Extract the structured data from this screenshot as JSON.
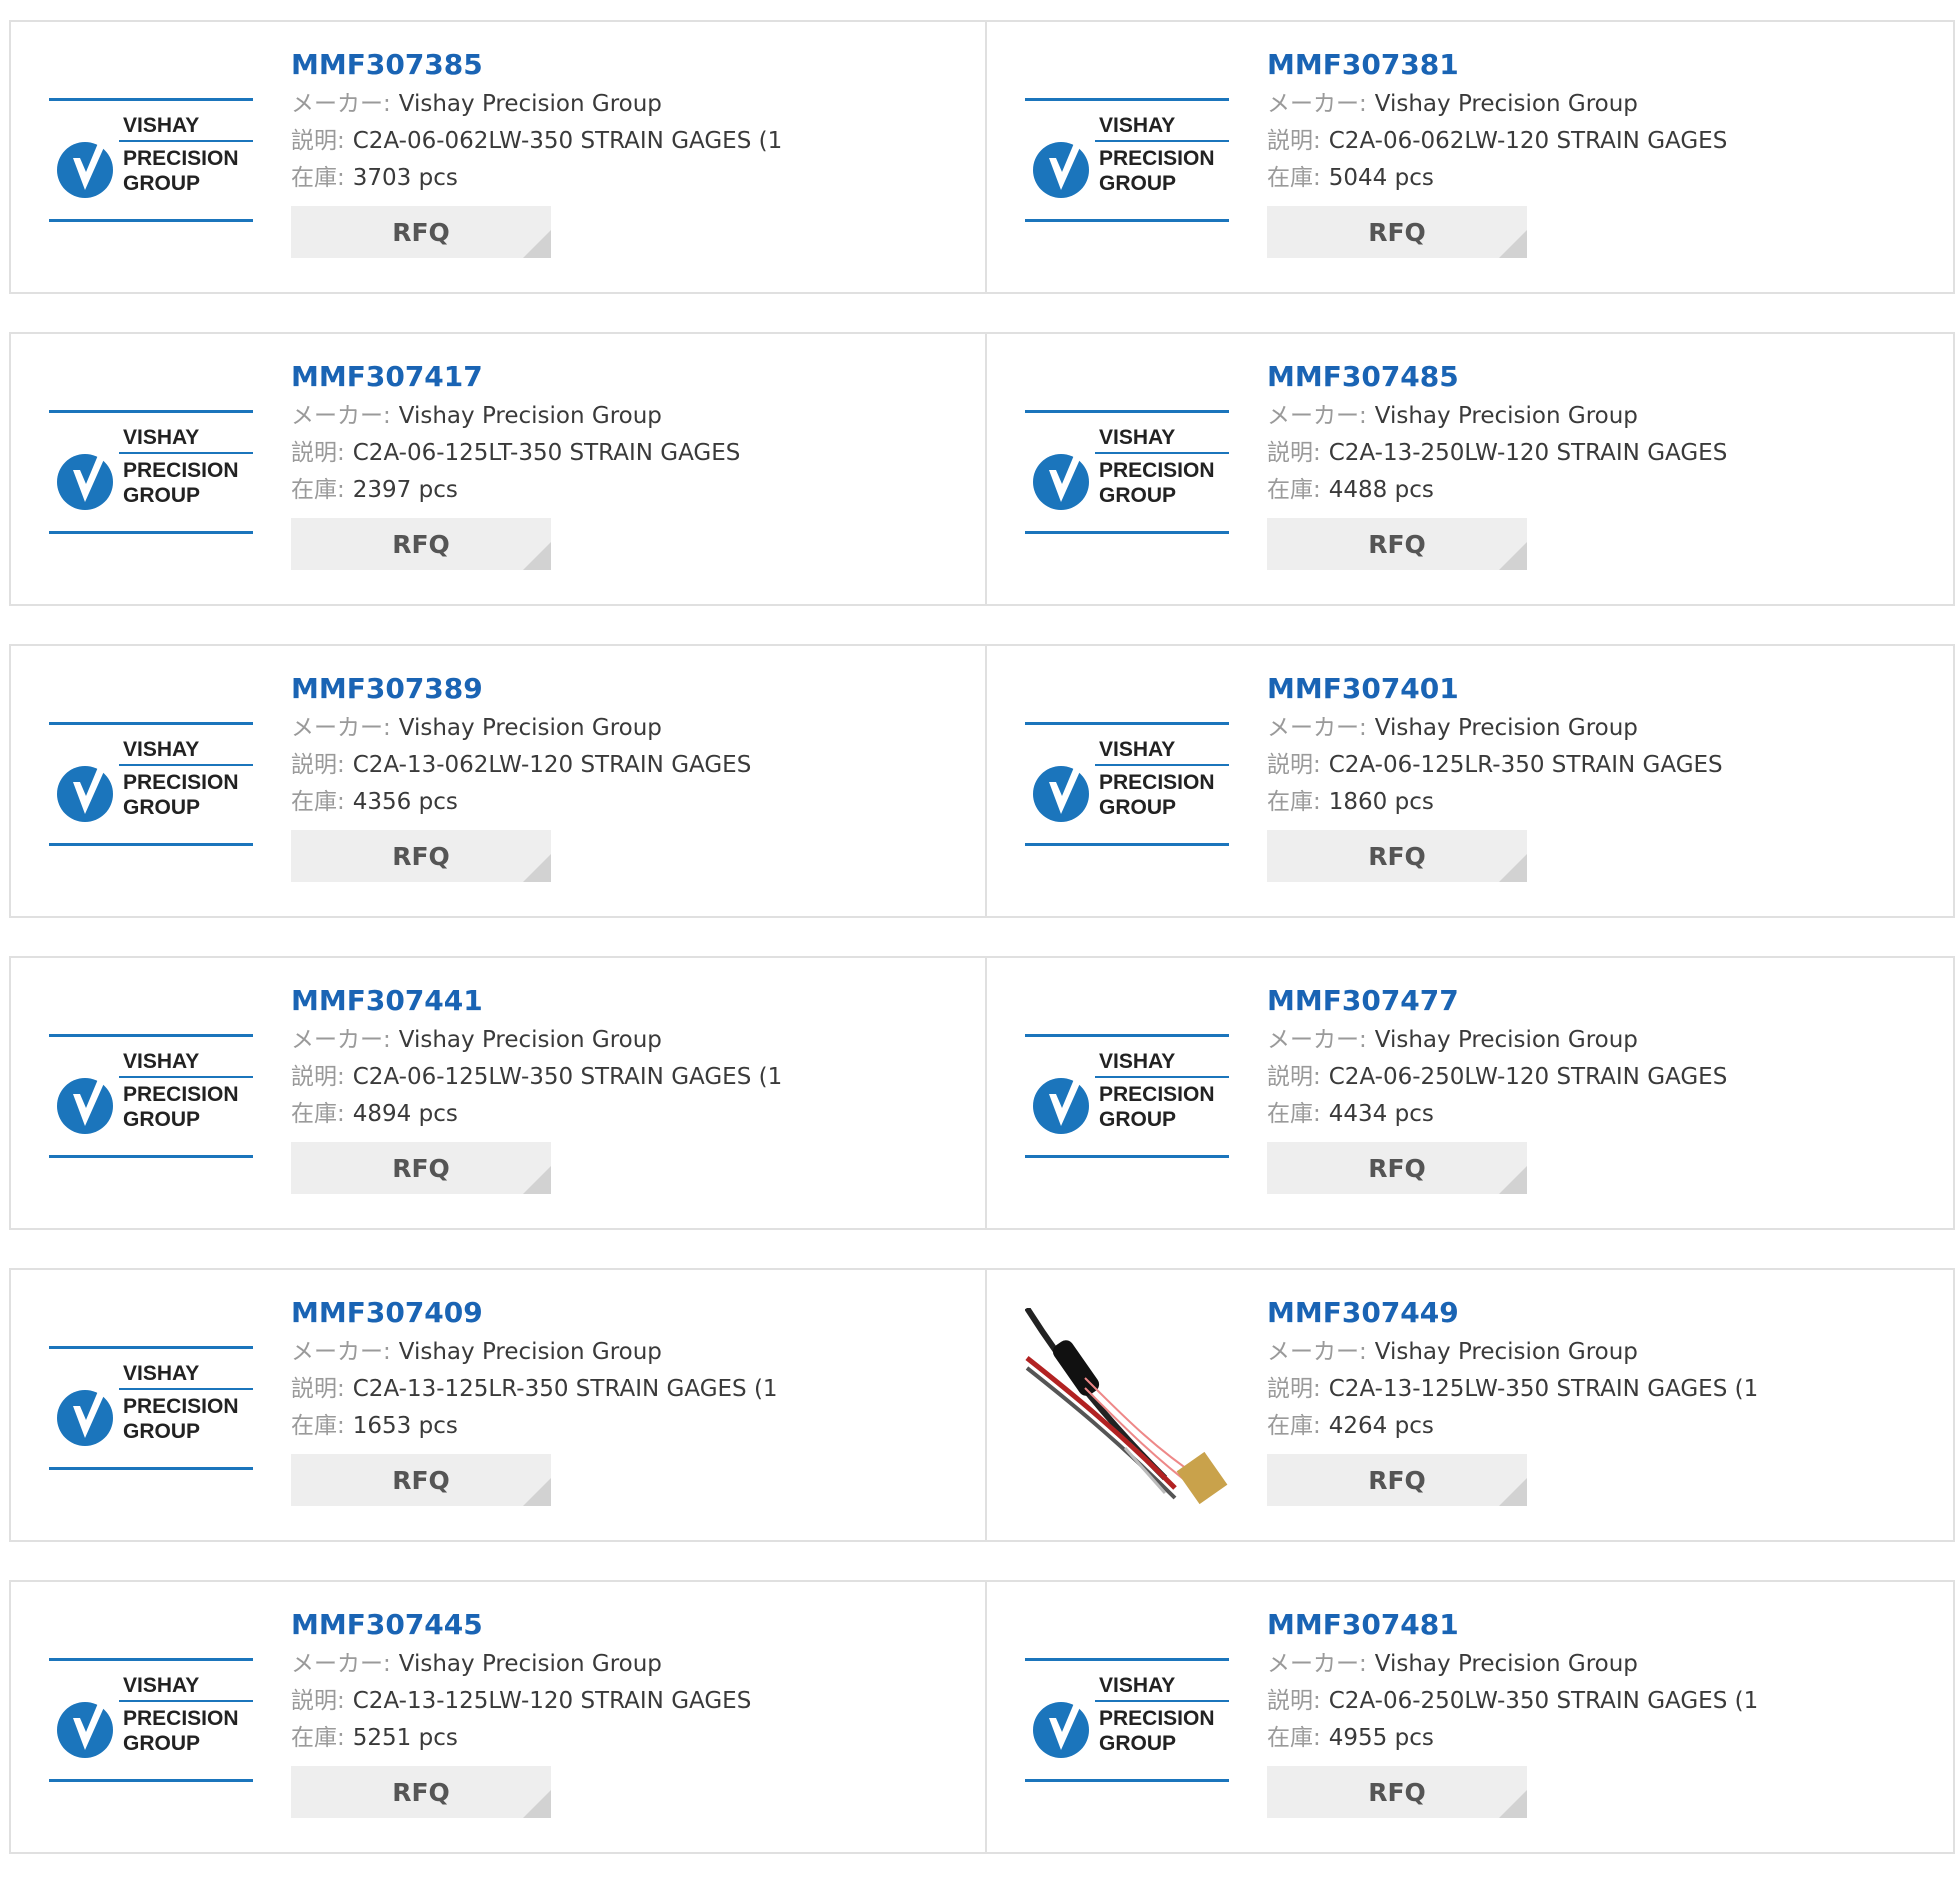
{
  "labels": {
    "maker": "メーカー:",
    "description": "説明:",
    "stock": "在庫:",
    "rfq": "RFQ"
  },
  "logo_text": {
    "line1": "VISHAY",
    "line2": "PRECISION",
    "line3": "GROUP"
  },
  "colors": {
    "part_link": "#1a64b4",
    "logo_blue": "#1b75bc",
    "button_bg": "#eeeeee"
  },
  "products": [
    {
      "part": "MMF307385",
      "maker": "Vishay Precision Group",
      "description": "C2A-06-062LW-350 STRAIN GAGES (1",
      "stock": "3703 pcs",
      "image": "vishay-logo"
    },
    {
      "part": "MMF307381",
      "maker": "Vishay Precision Group",
      "description": "C2A-06-062LW-120 STRAIN GAGES",
      "stock": "5044 pcs",
      "image": "vishay-logo"
    },
    {
      "part": "MMF307417",
      "maker": "Vishay Precision Group",
      "description": "C2A-06-125LT-350 STRAIN GAGES",
      "stock": "2397 pcs",
      "image": "vishay-logo"
    },
    {
      "part": "MMF307485",
      "maker": "Vishay Precision Group",
      "description": "C2A-13-250LW-120 STRAIN GAGES",
      "stock": "4488 pcs",
      "image": "vishay-logo"
    },
    {
      "part": "MMF307389",
      "maker": "Vishay Precision Group",
      "description": "C2A-13-062LW-120 STRAIN GAGES",
      "stock": "4356 pcs",
      "image": "vishay-logo"
    },
    {
      "part": "MMF307401",
      "maker": "Vishay Precision Group",
      "description": "C2A-06-125LR-350 STRAIN GAGES",
      "stock": "1860 pcs",
      "image": "vishay-logo"
    },
    {
      "part": "MMF307441",
      "maker": "Vishay Precision Group",
      "description": "C2A-06-125LW-350 STRAIN GAGES (1",
      "stock": "4894 pcs",
      "image": "vishay-logo"
    },
    {
      "part": "MMF307477",
      "maker": "Vishay Precision Group",
      "description": "C2A-06-250LW-120 STRAIN GAGES",
      "stock": "4434 pcs",
      "image": "vishay-logo"
    },
    {
      "part": "MMF307409",
      "maker": "Vishay Precision Group",
      "description": "C2A-13-125LR-350 STRAIN GAGES (1",
      "stock": "1653 pcs",
      "image": "vishay-logo"
    },
    {
      "part": "MMF307449",
      "maker": "Vishay Precision Group",
      "description": "C2A-13-125LW-350 STRAIN GAGES (1",
      "stock": "4264 pcs",
      "image": "strain-gage-photo"
    },
    {
      "part": "MMF307445",
      "maker": "Vishay Precision Group",
      "description": "C2A-13-125LW-120 STRAIN GAGES",
      "stock": "5251 pcs",
      "image": "vishay-logo"
    },
    {
      "part": "MMF307481",
      "maker": "Vishay Precision Group",
      "description": "C2A-06-250LW-350 STRAIN GAGES (1",
      "stock": "4955 pcs",
      "image": "vishay-logo"
    }
  ]
}
